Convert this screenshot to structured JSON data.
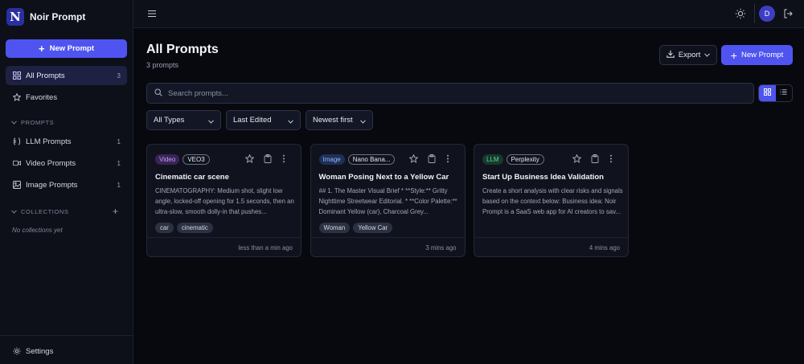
{
  "app": {
    "name": "Noir Prompt",
    "logo_letter": "N"
  },
  "sidebar": {
    "new_prompt_label": "New Prompt",
    "nav": [
      {
        "label": "All Prompts",
        "count": "3",
        "icon": "grid-icon",
        "active": true
      },
      {
        "label": "Favorites",
        "count": "",
        "icon": "star-icon",
        "active": false
      }
    ],
    "prompts_section": "PROMPTS",
    "prompt_types": [
      {
        "label": "LLM Prompts",
        "count": "1",
        "icon": "llm-icon"
      },
      {
        "label": "Video Prompts",
        "count": "1",
        "icon": "video-icon"
      },
      {
        "label": "Image Prompts",
        "count": "1",
        "icon": "image-icon"
      }
    ],
    "collections_section": "COLLECTIONS",
    "collections_empty": "No collections yet",
    "settings_label": "Settings"
  },
  "topbar": {
    "avatar_letter": "D"
  },
  "main": {
    "title": "All Prompts",
    "subtitle": "3 prompts",
    "export_label": "Export",
    "new_prompt_label": "New Prompt",
    "search_placeholder": "Search prompts...",
    "filters": {
      "type": "All Types",
      "sort_field": "Last Edited",
      "sort_order": "Newest first"
    }
  },
  "cards": [
    {
      "type": "Video",
      "type_color": "#c69bf5",
      "type_bg": "#3a2456",
      "model": "VEO3",
      "title": "Cinematic car scene",
      "description": "CINEMATOGRAPHY: Medium shot, slight low angle, locked-off opening for 1.5 seconds, then an ultra-slow, smooth dolly-in that pushes...",
      "tags": [
        "car",
        "cinematic"
      ],
      "time": "less than a min ago"
    },
    {
      "type": "Image",
      "type_color": "#8fb4ff",
      "type_bg": "#1f2f55",
      "model": "Nano Bana...",
      "title": "Woman Posing Next to a Yellow Car",
      "description": "## 1. The Master Visual Brief * **Style:** Gritty Nighttime Streetwear Editorial. * **Color Palette:** Dominant Yellow (car), Charcoal Grey...",
      "tags": [
        "Woman",
        "Yellow Car"
      ],
      "time": "3 mins ago"
    },
    {
      "type": "LLM",
      "type_color": "#5ad69a",
      "type_bg": "#173a2c",
      "model": "Perplexity",
      "title": "Start Up Business Idea Validation",
      "description": "Create a short analysis with clear risks and signals based on the context below: Business idea: Noir Prompt is a SaaS web app for AI creators to sav...",
      "tags": [],
      "time": "4 mins ago"
    }
  ]
}
